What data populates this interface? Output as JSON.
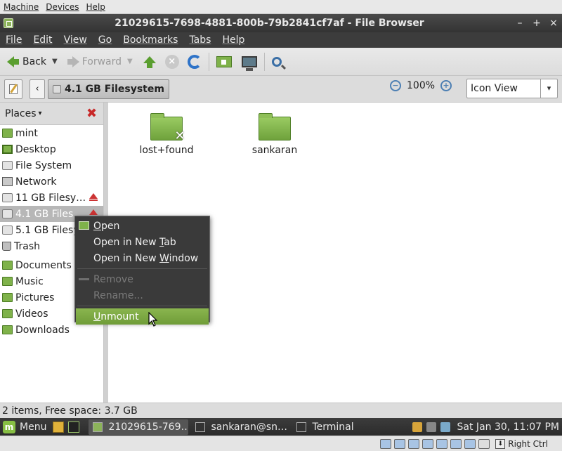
{
  "host_menubar": {
    "items": [
      "Machine",
      "Devices",
      "Help"
    ]
  },
  "window": {
    "title": "21029615-7698-4881-800b-79b2841cf7af - File Browser",
    "controls": {
      "minimize": "–",
      "maximize": "+",
      "close": "×"
    }
  },
  "menubar": {
    "items": [
      "File",
      "Edit",
      "View",
      "Go",
      "Bookmarks",
      "Tabs",
      "Help"
    ]
  },
  "toolbar": {
    "back_label": "Back",
    "forward_label": "Forward"
  },
  "location": {
    "back_arrow": "‹",
    "crumb": "4.1 GB Filesystem",
    "zoom_level": "100%",
    "zoom_out": "−",
    "zoom_in": "+",
    "view_mode": "Icon View",
    "view_chevron": "▾"
  },
  "sidebar": {
    "header": "Places",
    "header_chevron": "▾",
    "close_glyph": "✖",
    "devices": [
      {
        "label": "mint",
        "icon": "home-folder-icon"
      },
      {
        "label": "Desktop",
        "icon": "desktop-icon"
      },
      {
        "label": "File System",
        "icon": "drive-icon"
      },
      {
        "label": "Network",
        "icon": "network-icon"
      },
      {
        "label": "11 GB Filesy…",
        "icon": "drive-icon",
        "eject": true
      },
      {
        "label": "4.1 GB Files…",
        "icon": "drive-icon",
        "eject": true,
        "selected": true
      },
      {
        "label": "5.1 GB Filesy",
        "icon": "drive-icon"
      },
      {
        "label": "Trash",
        "icon": "trash-icon"
      }
    ],
    "bookmarks": [
      {
        "label": "Documents",
        "icon": "folder-icon"
      },
      {
        "label": "Music",
        "icon": "folder-icon"
      },
      {
        "label": "Pictures",
        "icon": "folder-icon"
      },
      {
        "label": "Videos",
        "icon": "folder-icon"
      },
      {
        "label": "Downloads",
        "icon": "folder-icon"
      }
    ]
  },
  "content": {
    "files": [
      {
        "name": "lost+found",
        "icon": "folder-locked-icon"
      },
      {
        "name": "sankaran",
        "icon": "folder-icon"
      }
    ]
  },
  "statusbar": {
    "text": "2 items, Free space: 3.7 GB"
  },
  "context_menu": {
    "open": {
      "pre": "",
      "ul": "O",
      "post": "pen"
    },
    "open_tab": {
      "pre": "Open in New ",
      "ul": "T",
      "post": "ab"
    },
    "open_window": {
      "pre": "Open in New ",
      "ul": "W",
      "post": "indow"
    },
    "remove": "Remove",
    "rename": "Rename...",
    "unmount": {
      "pre": "",
      "ul": "U",
      "post": "nmount"
    }
  },
  "taskbar": {
    "menu_label": "Menu",
    "tasks": [
      {
        "label": "21029615-769…",
        "active": true
      },
      {
        "label": "sankaran@sn…",
        "active": false
      },
      {
        "label": "Terminal",
        "active": false
      }
    ],
    "clock": "Sat Jan 30, 11:07 PM"
  },
  "vbox_status": {
    "host_key": "Right Ctrl"
  },
  "colors": {
    "accent_green": "#7fb24a",
    "menu_highlight": "#8ab54f",
    "eject_red": "#cc3333",
    "titlebar": "#3c3c3c"
  }
}
